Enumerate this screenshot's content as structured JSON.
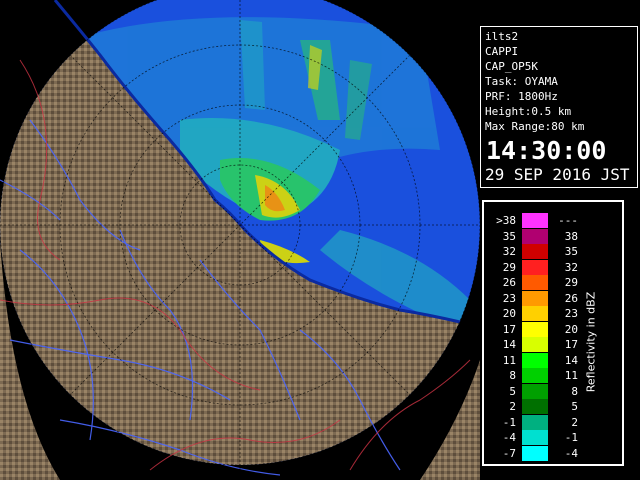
{
  "panel": {
    "lines": [
      "ilts2",
      "CAPPI",
      "CAP_OP5K",
      "Task: OYAMA",
      "PRF: 1800Hz",
      "Height:0.5 km",
      "Max Range:80 km"
    ],
    "time": "14:30:00",
    "date": "29 SEP 2016 JST"
  },
  "legend": {
    "unit_label": "Reflectivity in dBZ",
    "rows": [
      {
        "lo": ">38",
        "hi": "---",
        "color": "#ff33ff"
      },
      {
        "lo": "35",
        "hi": "38",
        "color": "#b00070"
      },
      {
        "lo": "32",
        "hi": "35",
        "color": "#d00000"
      },
      {
        "lo": "29",
        "hi": "32",
        "color": "#ff2020"
      },
      {
        "lo": "26",
        "hi": "29",
        "color": "#ff5a00"
      },
      {
        "lo": "23",
        "hi": "26",
        "color": "#ff9a00"
      },
      {
        "lo": "20",
        "hi": "23",
        "color": "#ffd000"
      },
      {
        "lo": "17",
        "hi": "20",
        "color": "#ffff00"
      },
      {
        "lo": "14",
        "hi": "17",
        "color": "#d8ff00"
      },
      {
        "lo": "11",
        "hi": "14",
        "color": "#00ff00"
      },
      {
        "lo": "8",
        "hi": "11",
        "color": "#00d000"
      },
      {
        "lo": "5",
        "hi": "8",
        "color": "#00a000"
      },
      {
        "lo": "2",
        "hi": "5",
        "color": "#007000"
      },
      {
        "lo": "-1",
        "hi": "2",
        "color": "#00b080"
      },
      {
        "lo": "-4",
        "hi": "-1",
        "color": "#00e0d0"
      },
      {
        "lo": "-7",
        "hi": "-4",
        "color": "#00ffff"
      }
    ]
  },
  "map": {
    "ocean_color": "#0033cc",
    "range_disc_color": "#1a55e0",
    "terrain_color": "#8a7358",
    "river_color": "#4466ff",
    "boundary_color": "#cc3344"
  }
}
